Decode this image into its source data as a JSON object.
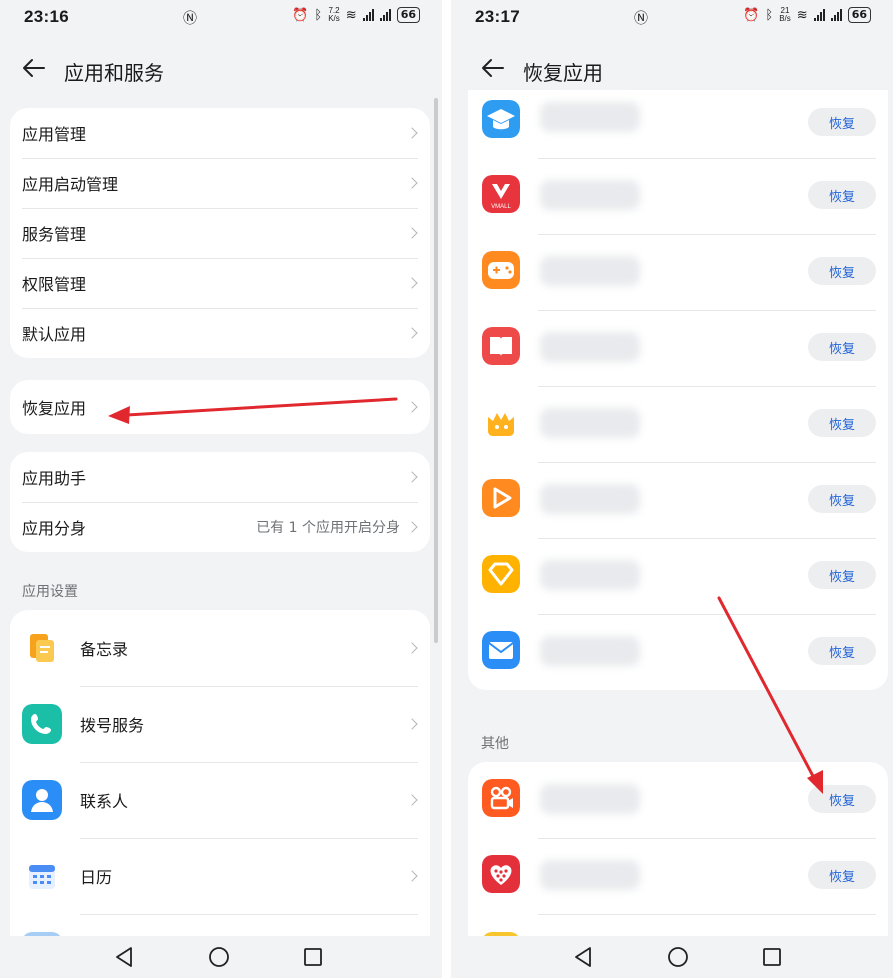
{
  "left": {
    "status": {
      "time": "23:16",
      "speed_top": "7.2",
      "speed_bottom": "K/s",
      "battery": "66"
    },
    "title": "应用和服务",
    "group1": [
      "应用管理",
      "应用启动管理",
      "服务管理",
      "权限管理",
      "默认应用"
    ],
    "group2": [
      "恢复应用"
    ],
    "group3": [
      {
        "label": "应用助手",
        "extra": ""
      },
      {
        "label": "应用分身",
        "extra": "已有 1 个应用开启分身"
      }
    ],
    "section_label": "应用设置",
    "settings_apps": [
      {
        "label": "备忘录",
        "icon": "memo-icon",
        "color": "#f29b1d"
      },
      {
        "label": "拨号服务",
        "icon": "phone-icon",
        "color": "#1bbfa8"
      },
      {
        "label": "联系人",
        "icon": "contacts-icon",
        "color": "#2b8ef7"
      },
      {
        "label": "日历",
        "icon": "calendar-icon",
        "color": "#4a8ef5"
      }
    ]
  },
  "right": {
    "status": {
      "time": "23:17",
      "speed_top": "21",
      "speed_bottom": "B/s",
      "battery": "66"
    },
    "title": "恢复应用",
    "restore_label": "恢复",
    "apps": [
      {
        "icon": "education-icon",
        "color": "#2e9cf0"
      },
      {
        "icon": "vmall-icon",
        "color": "#e8343c",
        "icon_text": "VMALL"
      },
      {
        "icon": "game-center-icon",
        "color": "#ff8a1f"
      },
      {
        "icon": "books-icon",
        "color": "#ef4a4a"
      },
      {
        "icon": "kids-icon",
        "color": "#ffb21e"
      },
      {
        "icon": "video-icon",
        "color": "#ff8a1f"
      },
      {
        "icon": "themes-icon",
        "color": "#ffb300"
      },
      {
        "icon": "email-icon",
        "color": "#2b8ef7"
      }
    ],
    "section_label": "其他",
    "other_apps": [
      {
        "icon": "kuaishou-icon",
        "color": "#ff5a1f"
      },
      {
        "icon": "pinduoduo-icon",
        "color": "#e4303a"
      }
    ]
  }
}
